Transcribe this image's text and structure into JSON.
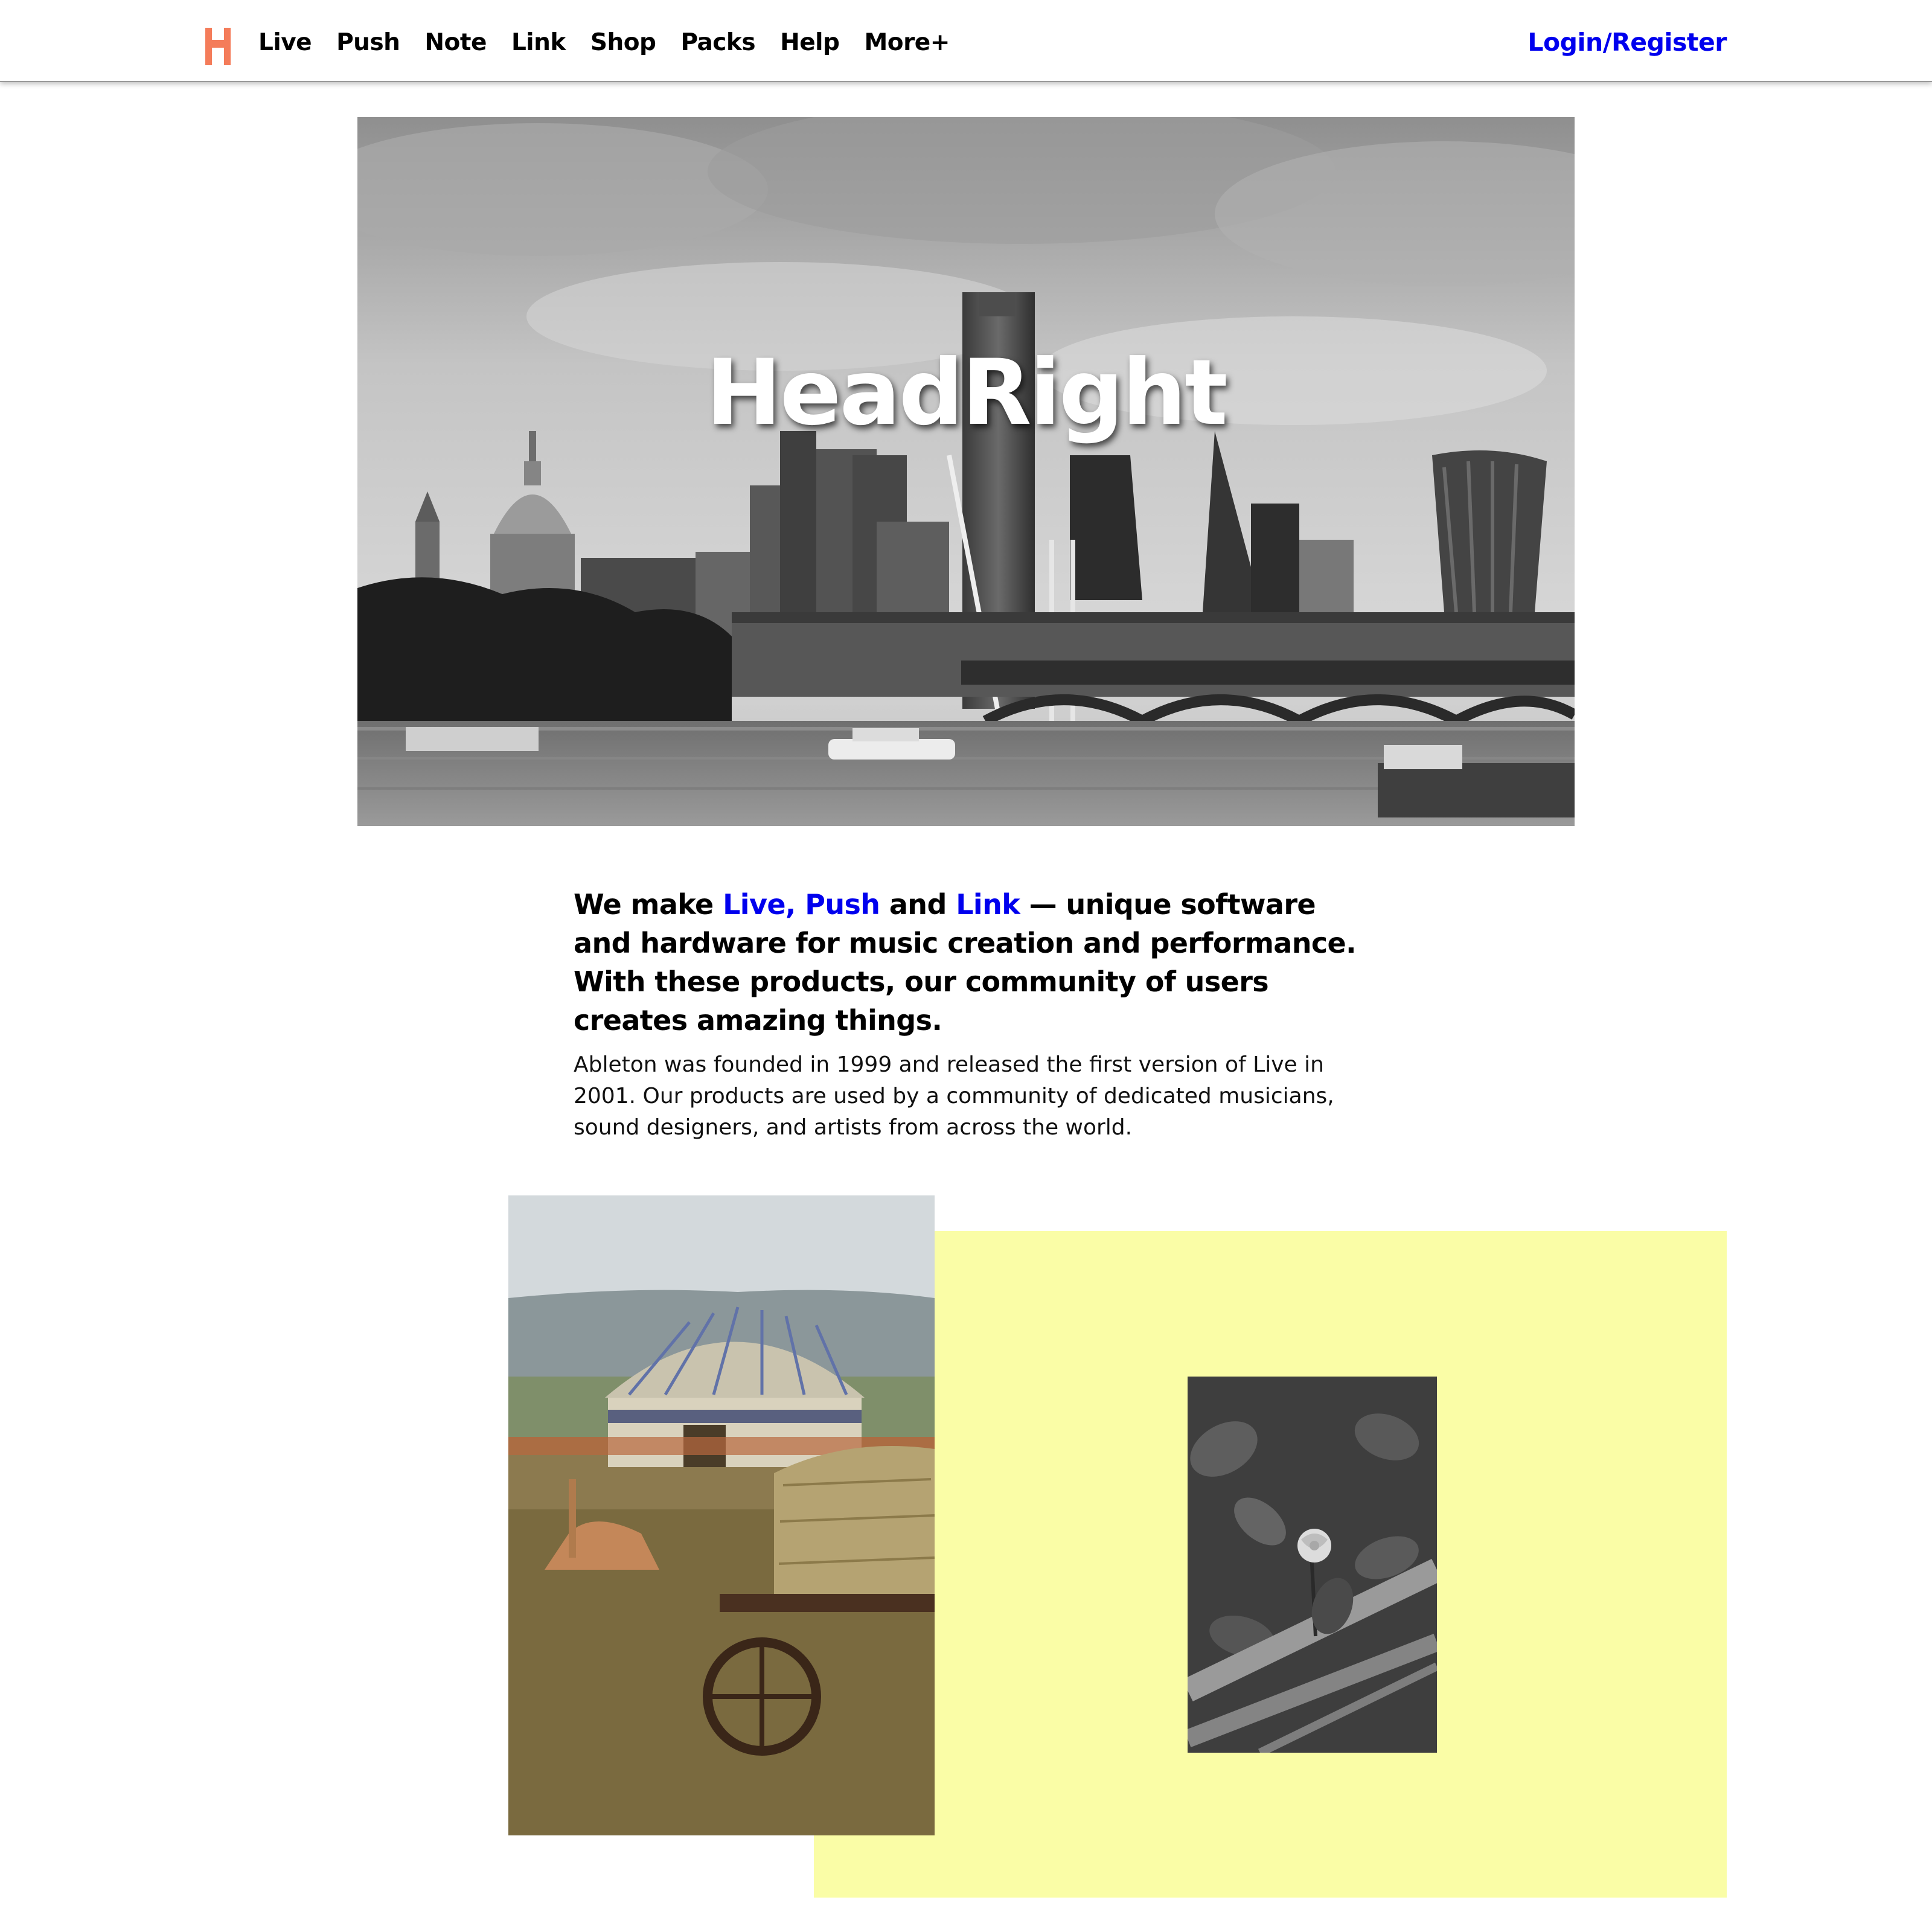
{
  "header": {
    "logo_letter": "H",
    "logo_color": "#f47c5a",
    "nav": [
      {
        "label": "Live"
      },
      {
        "label": "Push"
      },
      {
        "label": "Note"
      },
      {
        "label": "Link"
      },
      {
        "label": "Shop"
      },
      {
        "label": "Packs"
      },
      {
        "label": "Help"
      },
      {
        "label": "More+"
      }
    ],
    "login_label": "Login/Register",
    "login_color": "#0000ee"
  },
  "hero": {
    "title": "HeadRight",
    "image": "black-and-white-london-skyline"
  },
  "intro": {
    "headline_prefix": "We make ",
    "link_live": "Live,",
    "link_push": "Push",
    "headline_and": " and ",
    "link_link": "Link",
    "headline_suffix": " — unique software and hardware for music creation and performance. With these products, our community of users creates amazing things.",
    "link_color": "#0000ee",
    "body": "Ableton was founded in 1999 and released the first version of Live in 2001. Our products are used by a community of dedicated musicians, sound designers, and artists from across the world."
  },
  "gallery": {
    "accent_color": "#fafda6",
    "photo_left": "yurt-with-hay-cart",
    "photo_right": "black-and-white-rose"
  }
}
